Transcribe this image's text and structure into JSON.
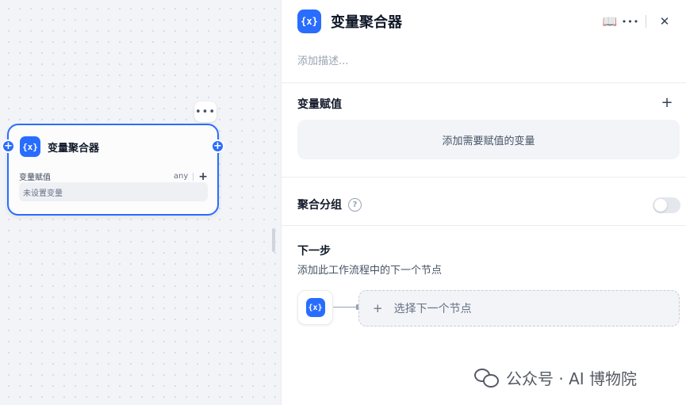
{
  "canvas": {
    "node": {
      "title": "变量聚合器",
      "icon": "variable-icon",
      "icon_text": "{x}",
      "more": "•••",
      "var_label": "变量赋值",
      "var_type": "any",
      "add": "+",
      "empty_text": "未设置变量",
      "handle": "+"
    }
  },
  "panel": {
    "title": "变量聚合器",
    "icon": "variable-icon",
    "icon_text": "{x}",
    "header_actions": {
      "docs_icon": "book-icon",
      "docs_glyph": "📖",
      "more_icon": "more-icon",
      "more_glyph": "•••",
      "close_icon": "close-icon",
      "close_glyph": "✕"
    },
    "description_placeholder": "添加描述...",
    "var_assign": {
      "title": "变量赋值",
      "add": "+",
      "empty_button": "添加需要赋值的变量"
    },
    "aggregate_group": {
      "title": "聚合分组",
      "help": "?",
      "enabled": false
    },
    "next_step": {
      "title": "下一步",
      "description": "添加此工作流程中的下一个节点",
      "node_icon_text": "{x}",
      "select_plus": "+",
      "select_label": "选择下一个节点"
    }
  },
  "watermark": {
    "text": "公众号 · AI 博物院",
    "icon": "wechat-icon"
  },
  "colors": {
    "accent": "#296dff",
    "canvas_bg": "#f2f4f7",
    "panel_bg": "#ffffff"
  }
}
